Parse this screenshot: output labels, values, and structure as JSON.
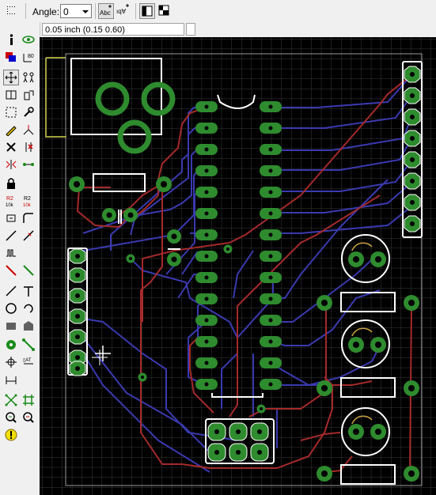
{
  "toolbar": {
    "angle_label": "Angle:",
    "angle_value": "0",
    "grid_icon": "dotted-grid-icon",
    "text_icon": "text-direction-icon",
    "mirror_icon": "mirror-text-icon",
    "layout_icon": "layout-view-icon"
  },
  "status": {
    "coordinates": "0.05 inch (0.15 0.60)"
  },
  "tools": [
    {
      "name": "info-icon"
    },
    {
      "name": "eye-icon"
    },
    {
      "name": "layers-icon"
    },
    {
      "name": "mark-icon"
    },
    {
      "name": "move-icon"
    },
    {
      "name": "group-icon"
    },
    {
      "name": "copy-icon"
    },
    {
      "name": "paste-icon"
    },
    {
      "name": "select-icon"
    },
    {
      "name": "wrench-icon"
    },
    {
      "name": "pencil-icon"
    },
    {
      "name": "split-icon"
    },
    {
      "name": "delete-icon"
    },
    {
      "name": "add-icon"
    },
    {
      "name": "mirror-icon"
    },
    {
      "name": "optimize-icon"
    },
    {
      "name": "lock-icon"
    },
    {
      "name": "name-icon"
    },
    {
      "name": "value-icon"
    },
    {
      "name": "smash-icon"
    },
    {
      "name": "miter-icon"
    },
    {
      "name": "route-icon"
    },
    {
      "name": "ripup-icon"
    },
    {
      "name": "signal-icon"
    },
    {
      "name": "wire-icon"
    },
    {
      "name": "text-icon"
    },
    {
      "name": "circle-icon"
    },
    {
      "name": "arc-icon"
    },
    {
      "name": "rect-icon"
    },
    {
      "name": "polygon-icon"
    },
    {
      "name": "via-icon"
    },
    {
      "name": "hole-icon"
    },
    {
      "name": "attribute-icon"
    },
    {
      "name": "dimension-icon"
    },
    {
      "name": "ratsnest-icon"
    },
    {
      "name": "auto-router-icon"
    },
    {
      "name": "drc-icon"
    },
    {
      "name": "erc-icon"
    },
    {
      "name": "errors-icon"
    }
  ],
  "colors": {
    "canvas": "#000000",
    "grid": "#404040",
    "top_trace": "#a52a2a",
    "bottom_trace": "#3a3ab0",
    "pad": "#2e8b2e",
    "silk": "#ffffff",
    "dimension": "#a0a040"
  }
}
